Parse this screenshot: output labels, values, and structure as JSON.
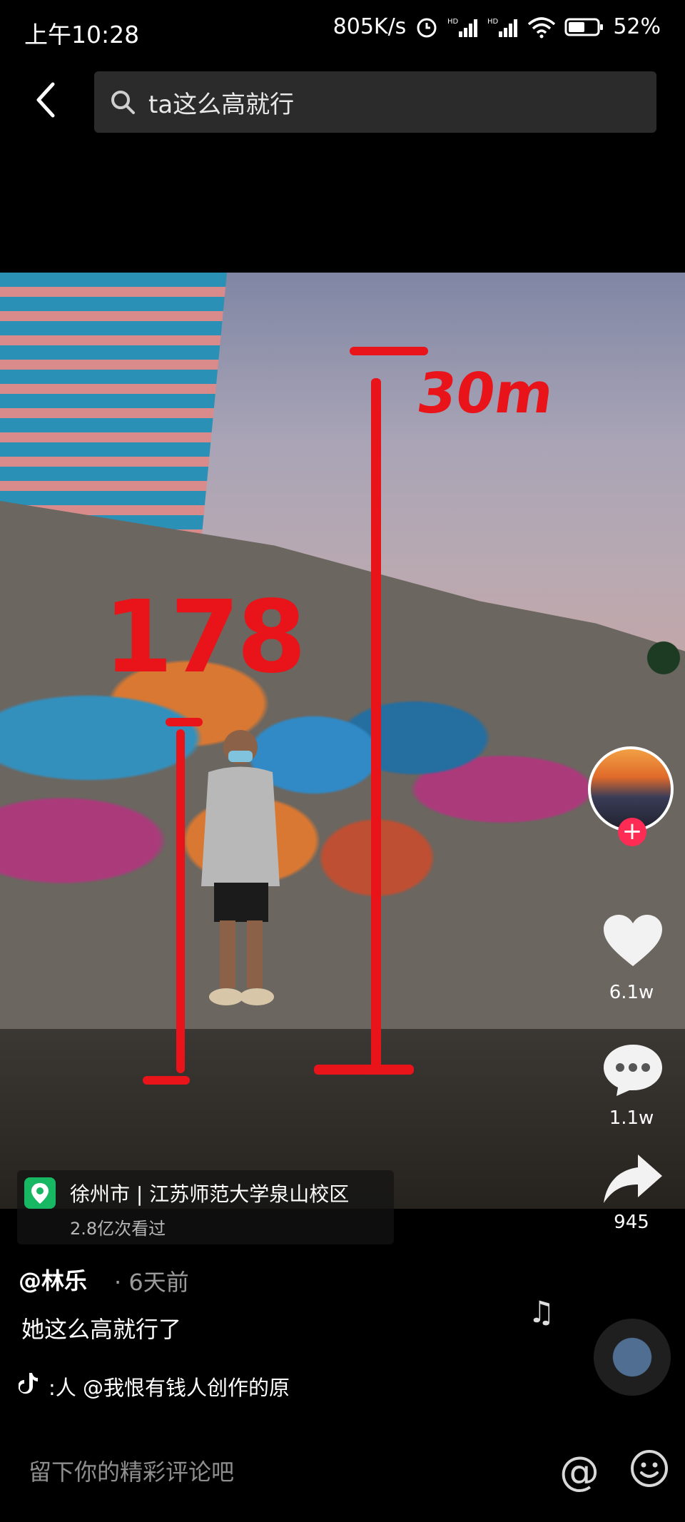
{
  "status_bar": {
    "time": "上午10:28",
    "network_speed": "805K/s",
    "signal_1": "HD",
    "signal_2": "HD",
    "battery": "52%"
  },
  "search": {
    "query": "ta这么高就行"
  },
  "video": {
    "annotation_height_short": "178",
    "annotation_height_tall": "30m"
  },
  "location": {
    "title": "徐州市 | 江苏师范大学泉山校区",
    "subtitle": "2.8亿次看过"
  },
  "actions": {
    "likes": "6.1w",
    "comments": "1.1w",
    "shares": "945"
  },
  "post": {
    "author": "@林乐",
    "time": "· 6天前",
    "caption": "她这么高就行了",
    "music": ":人    @我恨有钱人创作的原"
  },
  "comment_bar": {
    "placeholder": "留下你的精彩评论吧"
  },
  "colors": {
    "annotation_red": "#e8141a",
    "follow_badge": "#fe2c55",
    "location_pin": "#18b764"
  }
}
